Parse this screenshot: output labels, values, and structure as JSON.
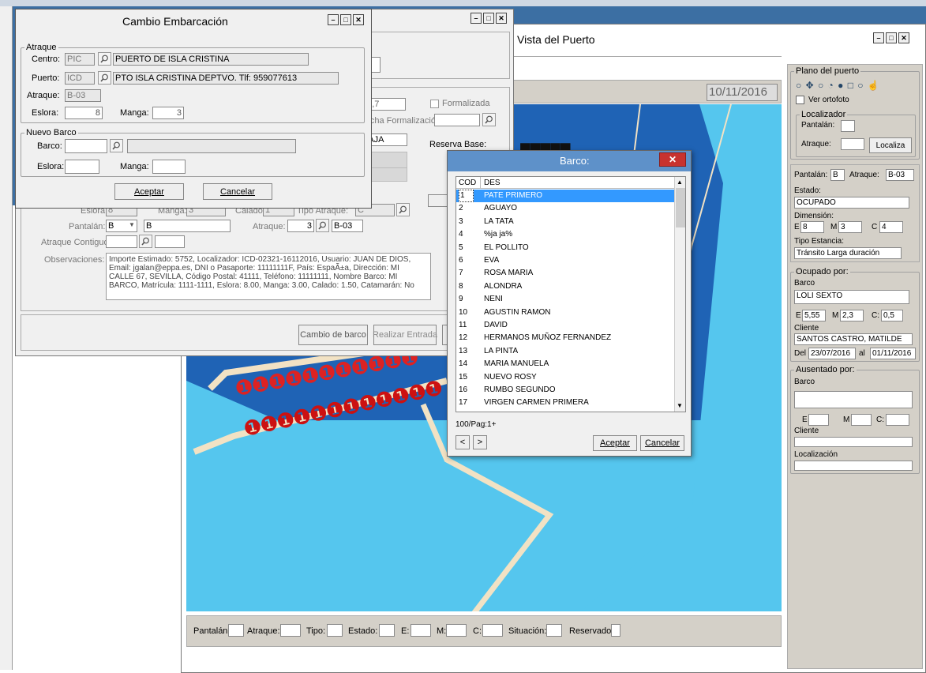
{
  "colors": {
    "desktop": "#3c6fa3",
    "sea": "#55c6ee",
    "panel": "#d4d0c8",
    "selection": "#3399ff",
    "close_red": "#c7322f"
  },
  "title_buttons": {
    "minimize": "–",
    "maximize": "□",
    "close": "✕"
  },
  "vista": {
    "title": "Vista del Puerto",
    "date": "10/11/2016",
    "right_panel": {
      "plano_title": "Plano del puerto",
      "ver_ortofoto": "Ver ortofoto",
      "localizador_title": "Localizador",
      "pantalan_label": "Pantalán:",
      "atraque_label": "Atraque:",
      "localiza_button": "Localiza",
      "info": {
        "pantalan_label": "Pantalán:",
        "pantalan": "B",
        "atraque_label": "Atraque:",
        "atraque": "B-03",
        "estado_label": "Estado:",
        "estado": "OCUPADO",
        "dimension_label": "Dimensión:",
        "e_label": "E",
        "e": "8",
        "m_label": "M",
        "m": "3",
        "c_label": "C",
        "c": "4",
        "tipo_label": "Tipo Estancia:",
        "tipo": "Tránsito Larga duración"
      },
      "ocupado": {
        "title": "Ocupado por:",
        "barco_label": "Barco",
        "barco": "LOLI SEXTO",
        "e": "5,55",
        "m": "2,3",
        "c": "0,5",
        "cliente_label": "Cliente",
        "cliente": "SANTOS CASTRO, MATILDE",
        "del_label": "Del",
        "desde": "23/07/2016",
        "al_label": "al",
        "hasta": "01/11/2016"
      },
      "ausentado": {
        "title": "Ausentado por:",
        "barco_label": "Barco",
        "cliente_label": "Cliente",
        "localizacion_label": "Localización",
        "e_label": "E",
        "m_label": "M",
        "c_label": "C:"
      }
    },
    "statusbar": {
      "pantalan": "Pantalán:",
      "atraque": "Atraque:",
      "tipo": "Tipo:",
      "estado": "Estado:",
      "e": "E:",
      "m": "M:",
      "c": "C:",
      "situacion": "Situación:",
      "reservado": "Reservado"
    }
  },
  "reserva": {
    "eslora_value": "12,7",
    "formalizada": "Formalizada",
    "fecha_formalizacion": "Fecha Formalización:",
    "baja": "BAJA",
    "reserva_base": "Reserva Base:",
    "row": {
      "eslora": "Eslora:",
      "eslora_val": "8",
      "manga": "Manga:",
      "manga_val": "3",
      "calado": "Calado:",
      "calado_val": "1",
      "tipo_atraque": "Tipo Atraque:",
      "tipo_atraque_val": "C"
    },
    "pantalan_label": "Pantalán:",
    "pantalan_val": "B",
    "pantalan_desc": "B",
    "atraque_label": "Atraque:",
    "atraque_num": "3",
    "atraque_val": "B-03",
    "contiguo_label": "Atraque Contiguo:",
    "obs_label": "Observaciones:",
    "observaciones": "Importe Estimado: 5752, Localizador: ICD-02321-16112016, Usuario: JUAN DE DIOS, Email: jgalan@eppa.es, DNI o Pasaporte: 11111111F, País: EspaÃ±a, Dirección: MI CALLE 67, SEVILLA, Código Postal: 41111, Teléfono: 11111111, Nombre Barco: MI BARCO, Matrícula: 1111-1111, Eslora: 8.00, Manga: 3.00, Calado: 1.50, Catamarán: No",
    "cambio_barco": "Cambio de barco",
    "realizar_entrada": "Realizar Entrada"
  },
  "cambio": {
    "title": "Cambio Embarcación",
    "atraque_group": "Atraque",
    "centro_label": "Centro:",
    "centro": "PIC",
    "centro_desc": "PUERTO DE ISLA CRISTINA",
    "puerto_label": "Puerto:",
    "puerto": "ICD",
    "puerto_desc": "PTO ISLA CRISTINA DEPTVO. Tlf: 959077613",
    "atraque_label": "Atraque:",
    "atraque": "B-03",
    "eslora_label": "Eslora:",
    "eslora": "8",
    "manga_label": "Manga:",
    "manga": "3",
    "nuevo_group": "Nuevo Barco",
    "barco_label": "Barco:",
    "eslora2_label": "Eslora:",
    "manga2_label": "Manga:",
    "aceptar": "Aceptar",
    "cancelar": "Cancelar"
  },
  "barco": {
    "title": "Barco:",
    "col_cod": "COD",
    "col_des": "DES",
    "rows": [
      {
        "cod": "1",
        "des": "PATE PRIMERO"
      },
      {
        "cod": "2",
        "des": "AGUAYO"
      },
      {
        "cod": "3",
        "des": "LA TATA"
      },
      {
        "cod": "4",
        "des": "%ja ja%"
      },
      {
        "cod": "5",
        "des": "EL POLLITO"
      },
      {
        "cod": "6",
        "des": "EVA"
      },
      {
        "cod": "7",
        "des": "ROSA MARIA"
      },
      {
        "cod": "8",
        "des": "ALONDRA"
      },
      {
        "cod": "9",
        "des": "NENI"
      },
      {
        "cod": "10",
        "des": "AGUSTIN RAMON"
      },
      {
        "cod": "11",
        "des": "DAVID"
      },
      {
        "cod": "12",
        "des": "HERMANOS MUÑOZ FERNANDEZ"
      },
      {
        "cod": "13",
        "des": "LA PINTA"
      },
      {
        "cod": "14",
        "des": "MARIA MANUELA"
      },
      {
        "cod": "15",
        "des": "NUEVO ROSY"
      },
      {
        "cod": "16",
        "des": "RUMBO SEGUNDO"
      },
      {
        "cod": "17",
        "des": "VIRGEN CARMEN PRIMERA"
      }
    ],
    "paging": "100/Pag:1+",
    "prev": "<",
    "next": ">",
    "aceptar": "Aceptar",
    "cancelar": "Cancelar"
  }
}
